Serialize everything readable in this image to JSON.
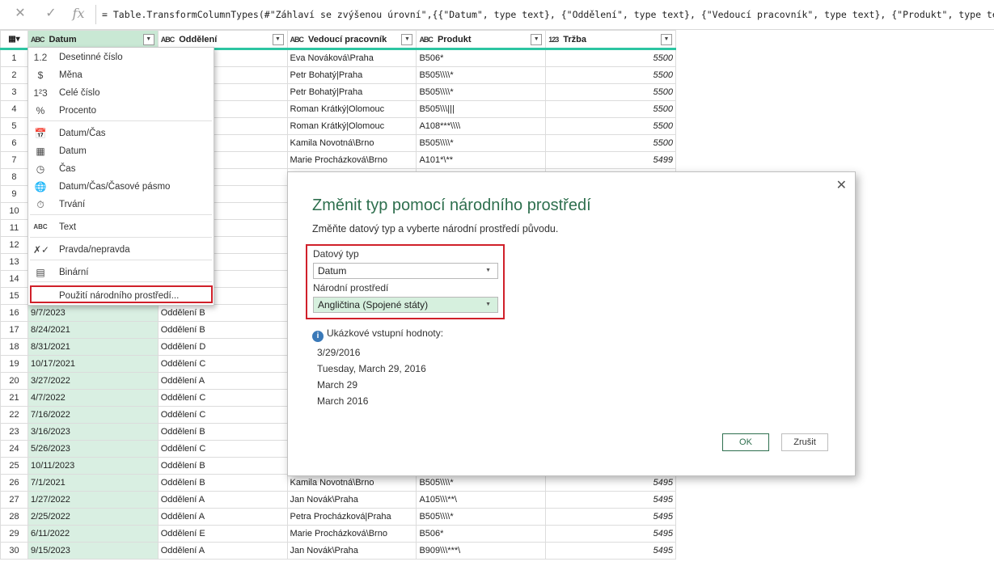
{
  "formula_bar": {
    "cancel_icon": "✕",
    "confirm_icon": "✓",
    "fx_label": "fx",
    "formula": "= Table.TransformColumnTypes(#\"Záhlaví se zvýšenou úrovní\",{{\"Datum\", type text}, {\"Oddělení\", type text}, {\"Vedoucí pracovník\", type text}, {\"Produkt\", type text},"
  },
  "columns": [
    {
      "icon": "ABC",
      "name": "Datum"
    },
    {
      "icon": "ABC",
      "name": "Oddělení"
    },
    {
      "icon": "ABC",
      "name": "Vedoucí pracovník"
    },
    {
      "icon": "ABC",
      "name": "Produkt"
    },
    {
      "icon": "123",
      "name": "Tržba"
    }
  ],
  "rows": [
    {
      "n": "1",
      "datum": "",
      "odd": "",
      "ved": "Eva Nováková\\Praha",
      "prod": "B506*",
      "trzba": "5500"
    },
    {
      "n": "2",
      "datum": "",
      "odd": "",
      "ved": "Petr Bohatý|Praha",
      "prod": "B505\\\\\\\\*",
      "trzba": "5500"
    },
    {
      "n": "3",
      "datum": "",
      "odd": "",
      "ved": "Petr Bohatý|Praha",
      "prod": "B505\\\\\\\\*",
      "trzba": "5500"
    },
    {
      "n": "4",
      "datum": "",
      "odd": "",
      "ved": "Roman Krátký|Olomouc",
      "prod": "B505\\\\\\|||",
      "trzba": "5500"
    },
    {
      "n": "5",
      "datum": "",
      "odd": "",
      "ved": "Roman Krátký|Olomouc",
      "prod": "A108***\\\\\\\\",
      "trzba": "5500"
    },
    {
      "n": "6",
      "datum": "",
      "odd": "",
      "ved": "Kamila Novotná\\Brno",
      "prod": "B505\\\\\\\\*",
      "trzba": "5500"
    },
    {
      "n": "7",
      "datum": "",
      "odd": "",
      "ved": "Marie Procházková\\Brno",
      "prod": "A101*\\**",
      "trzba": "5499"
    },
    {
      "n": "8",
      "datum": "",
      "odd": "",
      "ved": "",
      "prod": "",
      "trzba": ""
    },
    {
      "n": "9",
      "datum": "",
      "odd": "",
      "ved": "",
      "prod": "",
      "trzba": ""
    },
    {
      "n": "10",
      "datum": "",
      "odd": "",
      "ved": "",
      "prod": "",
      "trzba": ""
    },
    {
      "n": "11",
      "datum": "",
      "odd": "",
      "ved": "",
      "prod": "",
      "trzba": ""
    },
    {
      "n": "12",
      "datum": "",
      "odd": "",
      "ved": "",
      "prod": "",
      "trzba": ""
    },
    {
      "n": "13",
      "datum": "",
      "odd": "",
      "ved": "",
      "prod": "",
      "trzba": ""
    },
    {
      "n": "14",
      "datum": "",
      "odd": "",
      "ved": "",
      "prod": "",
      "trzba": ""
    },
    {
      "n": "15",
      "datum": "",
      "odd": "",
      "ved": "",
      "prod": "",
      "trzba": ""
    },
    {
      "n": "16",
      "datum": "9/7/2023",
      "odd": "Oddělení B",
      "ved": "",
      "prod": "",
      "trzba": ""
    },
    {
      "n": "17",
      "datum": "8/24/2021",
      "odd": "Oddělení B",
      "ved": "",
      "prod": "",
      "trzba": ""
    },
    {
      "n": "18",
      "datum": "8/31/2021",
      "odd": "Oddělení D",
      "ved": "",
      "prod": "",
      "trzba": ""
    },
    {
      "n": "19",
      "datum": "10/17/2021",
      "odd": "Oddělení C",
      "ved": "",
      "prod": "",
      "trzba": ""
    },
    {
      "n": "20",
      "datum": "3/27/2022",
      "odd": "Oddělení A",
      "ved": "",
      "prod": "",
      "trzba": ""
    },
    {
      "n": "21",
      "datum": "4/7/2022",
      "odd": "Oddělení C",
      "ved": "",
      "prod": "",
      "trzba": ""
    },
    {
      "n": "22",
      "datum": "7/16/2022",
      "odd": "Oddělení C",
      "ved": "",
      "prod": "",
      "trzba": ""
    },
    {
      "n": "23",
      "datum": "3/16/2023",
      "odd": "Oddělení B",
      "ved": "",
      "prod": "",
      "trzba": ""
    },
    {
      "n": "24",
      "datum": "5/26/2023",
      "odd": "Oddělení C",
      "ved": "",
      "prod": "",
      "trzba": ""
    },
    {
      "n": "25",
      "datum": "10/11/2023",
      "odd": "Oddělení B",
      "ved": "",
      "prod": "",
      "trzba": ""
    },
    {
      "n": "26",
      "datum": "7/1/2021",
      "odd": "Oddělení B",
      "ved": "Kamila Novotná\\Brno",
      "prod": "B505\\\\\\\\*",
      "trzba": "5495"
    },
    {
      "n": "27",
      "datum": "1/27/2022",
      "odd": "Oddělení A",
      "ved": "Jan Novák\\Praha",
      "prod": "A105\\\\\\**\\",
      "trzba": "5495"
    },
    {
      "n": "28",
      "datum": "2/25/2022",
      "odd": "Oddělení A",
      "ved": "Petra Procházková|Praha",
      "prod": "B505\\\\\\\\*",
      "trzba": "5495"
    },
    {
      "n": "29",
      "datum": "6/11/2022",
      "odd": "Oddělení E",
      "ved": "Marie Procházková\\Brno",
      "prod": "B506*",
      "trzba": "5495"
    },
    {
      "n": "30",
      "datum": "9/15/2023",
      "odd": "Oddělení A",
      "ved": "Jan Novák\\Praha",
      "prod": "B909\\\\\\***\\",
      "trzba": "5495"
    }
  ],
  "type_menu": {
    "items": [
      {
        "icon": "1.2",
        "label": "Desetinné číslo"
      },
      {
        "icon": "$",
        "label": "Měna"
      },
      {
        "icon": "1²3",
        "label": "Celé číslo"
      },
      {
        "icon": "%",
        "label": "Procento"
      },
      {
        "icon": "📅",
        "label": "Datum/Čas"
      },
      {
        "icon": "▦",
        "label": "Datum"
      },
      {
        "icon": "◷",
        "label": "Čas"
      },
      {
        "icon": "🌐",
        "label": "Datum/Čas/Časové pásmo"
      },
      {
        "icon": "⏱",
        "label": "Trvání"
      },
      {
        "icon": "ABC",
        "label": "Text"
      },
      {
        "icon": "✗✓",
        "label": "Pravda/nepravda"
      },
      {
        "icon": "▤",
        "label": "Binární"
      },
      {
        "icon": "",
        "label": "Použití národního prostředí..."
      }
    ]
  },
  "dialog": {
    "close_icon": "✕",
    "title": "Změnit typ pomocí národního prostředí",
    "subtitle": "Změňte datový typ a vyberte národní prostředí původu.",
    "data_type_label": "Datový typ",
    "data_type_value": "Datum",
    "locale_label": "Národní prostředí",
    "locale_value": "Angličtina (Spojené státy)",
    "info_icon": "i",
    "sample_label": "Ukázkové vstupní hodnoty:",
    "samples": [
      "3/29/2016",
      "Tuesday, March 29, 2016",
      "March 29",
      "March 2016"
    ],
    "ok_label": "OK",
    "cancel_label": "Zrušit"
  },
  "colors": {
    "accent": "#2e6f4e",
    "highlight": "#d0202a",
    "date_column": "#d9efe2",
    "header_rule": "#2dc5a2"
  }
}
